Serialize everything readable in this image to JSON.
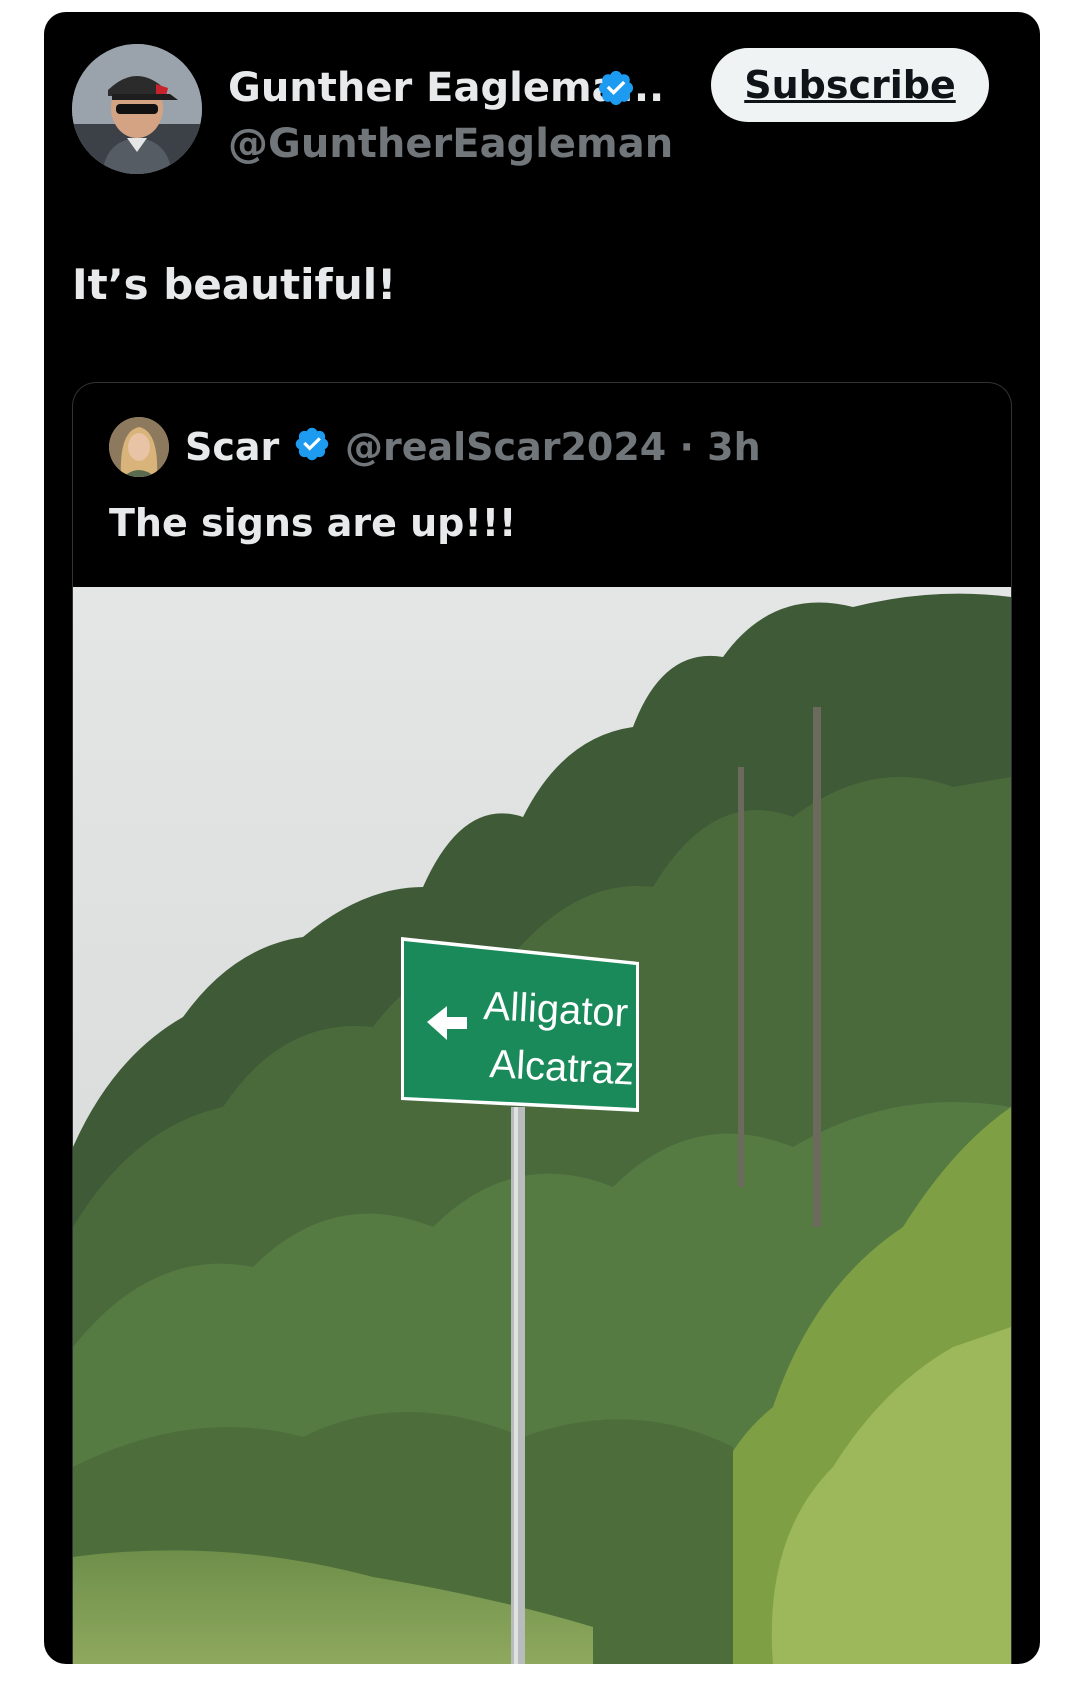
{
  "tweet": {
    "author_name": "Gunther Eaglema...",
    "author_handle": "@GuntherEagleman",
    "subscribe_label": "Subscribe",
    "text": "It’s beautiful!"
  },
  "quoted": {
    "author_name": "Scar",
    "author_handle": "@realScar2024",
    "separator": "·",
    "time": "3h",
    "text": "The signs are up!!!",
    "image": {
      "sign_line1": "Alligator",
      "sign_line2": "Alcatraz"
    }
  },
  "colors": {
    "background": "#000000",
    "verified": "#1d9bf0",
    "sign_green": "#1b8a5a"
  },
  "icons": [
    "verified-badge-icon",
    "left-arrow-icon"
  ]
}
